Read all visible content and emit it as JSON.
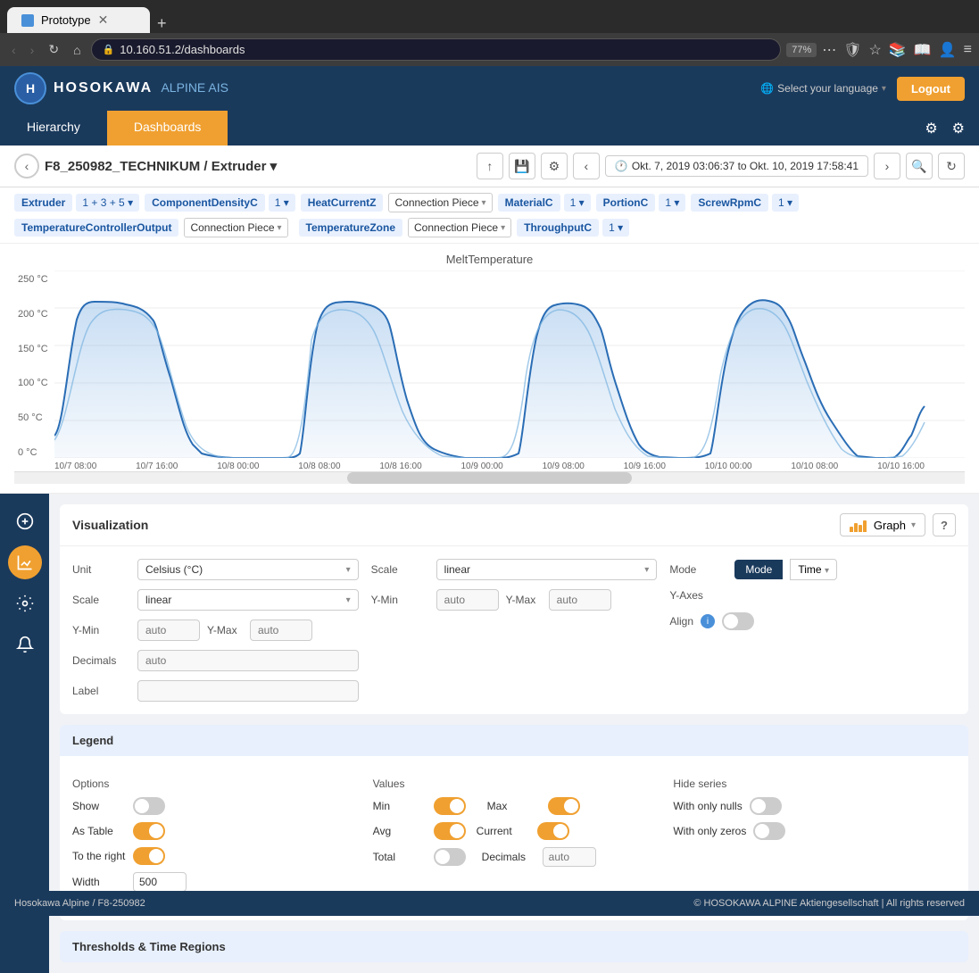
{
  "browser": {
    "tab_title": "Prototype",
    "url": "10.160.51.2/dashboards",
    "zoom": "77%",
    "new_tab_icon": "+",
    "nav_back": "‹",
    "nav_forward": "›",
    "nav_refresh": "↻",
    "nav_home": "⌂"
  },
  "header": {
    "logo_initials": "H",
    "logo_name": "HOSOKAWA",
    "logo_sub": "ALPINE AIS",
    "language_label": "Select your language",
    "logout_label": "Logout"
  },
  "nav": {
    "tab_hierarchy": "Hierarchy",
    "tab_dashboards": "Dashboards"
  },
  "breadcrumb": {
    "path": "F8_250982_TECHNIKUM / Extruder ▾"
  },
  "time_range": {
    "label": "Okt. 7, 2019 03:06:37 to Okt. 10, 2019 17:58:41"
  },
  "filters": [
    {
      "label": "Extruder",
      "value": "1 + 3 + 5 ▾"
    },
    {
      "label": "ComponentDensityC",
      "value": "1 ▾"
    },
    {
      "label": "HeatCurrentZ",
      "value": ""
    },
    {
      "label": "Connection Piece",
      "value": "▾"
    },
    {
      "label": "MaterialC",
      "value": "1 ▾"
    },
    {
      "label": "PortionC",
      "value": "1 ▾"
    },
    {
      "label": "ScrewRpmC",
      "value": "1 ▾"
    },
    {
      "label": "TemperatureControllerOutput",
      "value": ""
    },
    {
      "label": "Connection Piece",
      "value": "▾"
    },
    {
      "label": "TemperatureZone",
      "value": ""
    },
    {
      "label": "Connection Piece",
      "value": "▾"
    },
    {
      "label": "ThroughputC",
      "value": "1 ▾"
    }
  ],
  "chart": {
    "title": "MeltTemperature",
    "y_axis_labels": [
      "250 °C",
      "200 °C",
      "150 °C",
      "100 °C",
      "50 °C",
      "0 °C"
    ],
    "x_axis_labels": [
      "10/7 08:00",
      "10/7 16:00",
      "10/8 00:00",
      "10/8 08:00",
      "10/8 16:00",
      "10/9 00:00",
      "10/9 08:00",
      "10/9 16:00",
      "10/10 00:00",
      "10/10 08:00",
      "10/10 16:00"
    ]
  },
  "visualization": {
    "title": "Visualization",
    "type_label": "Graph",
    "help_label": "?",
    "unit_label": "Unit",
    "unit_value": "Celsius (°C)",
    "scale_label": "Scale",
    "scale_value": "linear",
    "scale_label2": "Scale",
    "scale_value2": "linear",
    "ymin_label": "Y-Min",
    "ymax_label": "Y-Max",
    "ymin_placeholder": "auto",
    "ymax_placeholder": "auto",
    "decimals_label": "Decimals",
    "decimals_placeholder": "auto",
    "label_label": "Label",
    "label_value": "",
    "scale_right_label": "Scale",
    "scale_right_value": "linear",
    "ymin_right_label": "Y-Min",
    "ymax_right_label": "Y-Max",
    "ymin_right_placeholder": "auto",
    "ymax_right_placeholder": "auto",
    "mode_label": "Mode",
    "mode_value": "Time",
    "yaxes_label": "Y-Axes",
    "align_label": "Align"
  },
  "legend": {
    "title": "Legend",
    "options_title": "Options",
    "values_title": "Values",
    "hide_series_title": "Hide series",
    "show_label": "Show",
    "show_on": false,
    "as_table_label": "As Table",
    "as_table_on": true,
    "to_right_label": "To the right",
    "to_right_on": true,
    "width_label": "Width",
    "width_value": "500",
    "min_label": "Min",
    "min_on": true,
    "max_label": "Max",
    "max_on": true,
    "avg_label": "Avg",
    "avg_on": true,
    "current_label": "Current",
    "current_on": true,
    "total_label": "Total",
    "total_on": false,
    "decimals_label": "Decimals",
    "decimals_placeholder": "auto",
    "with_only_nulls_label": "With only nulls",
    "with_only_nulls_on": false,
    "with_only_zeros_label": "With only zeros",
    "with_only_zeros_on": false
  },
  "thresholds": {
    "title": "Thresholds & Time Regions"
  },
  "sidebar": {
    "icons": [
      "☰",
      "📊",
      "⚙",
      "🔔"
    ]
  },
  "footer": {
    "left": "Hosokawa Alpine /  F8-250982",
    "right": "© HOSOKAWA ALPINE Aktiengesellschaft | All rights reserved"
  }
}
